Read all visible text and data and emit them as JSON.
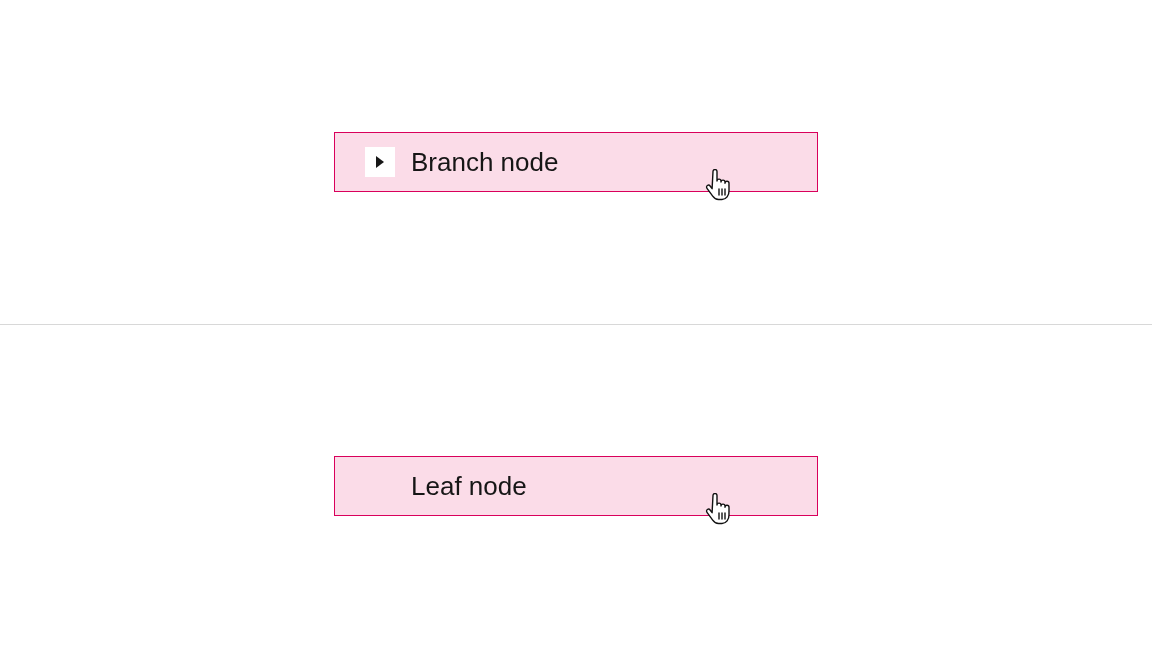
{
  "nodes": [
    {
      "kind": "branch",
      "label": "Branch node",
      "expanded": false,
      "hovered": true
    },
    {
      "kind": "leaf",
      "label": "Leaf node",
      "hovered": true
    }
  ]
}
